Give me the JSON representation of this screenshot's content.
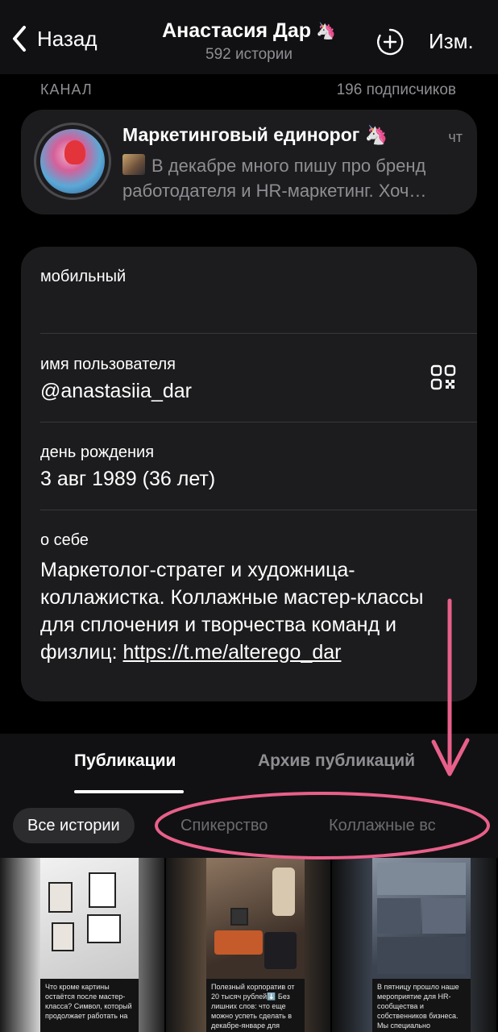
{
  "nav": {
    "back_label": "Назад",
    "title": "Анастасия Дар",
    "title_emoji": "🦄",
    "subtitle": "592 истории",
    "edit_label": "Изм."
  },
  "channel": {
    "section_label": "КАНАЛ",
    "subscribers": "196 подписчиков",
    "name": "Маркетинговый единорог 🦄",
    "time": "чт",
    "preview_line1": "В декабре много пишу про бренд",
    "preview_line2": "работодателя и HR-маркетинг. Хоч…"
  },
  "info": {
    "phone_label": "мобильный",
    "username_label": "имя пользователя",
    "username_value": "@anastasiia_dar",
    "birthday_label": "день рождения",
    "birthday_value": "3 авг 1989 (36 лет)",
    "about_label": "о себе",
    "about_text": "Маркетолог-стратег и художница-коллажистка. Коллажные мастер-классы для сплочения и творчества команд и физлиц: ",
    "about_link": "https://t.me/alterego_dar"
  },
  "tabs": {
    "items": [
      "Публикации",
      "Архив публикаций"
    ],
    "active": "Публикации"
  },
  "filters": {
    "active": "Все истории",
    "items": [
      "Все истории",
      "Спикерство",
      "Коллажные вс"
    ]
  },
  "stories": [
    {
      "caption": "Что кроме картины остаётся после мастер-класса? Символ, который продолжает работать на"
    },
    {
      "caption": "Полезный корпоратив от 20 тысяч рублей⬇️ Без лишних слов: что еще можно успеть сделать в декабре-январе для ваших сотрудников такого"
    },
    {
      "caption": "В пятницу прошло наше мероприятие для HR-сообщества и собственников бизнеса. Мы специально закладываем время на"
    }
  ],
  "colors": {
    "background": "#000000",
    "card": "#1c1c1e",
    "secondary_text": "#8e8e93",
    "annotation": "#e8608a"
  }
}
